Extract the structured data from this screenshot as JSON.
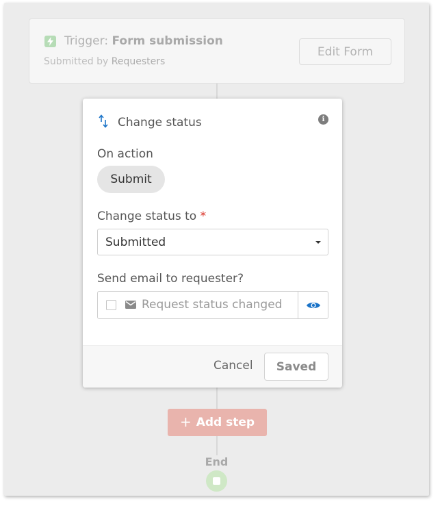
{
  "trigger": {
    "prefix": "Trigger:",
    "name": "Form submission",
    "sub_prefix": "Submitted by",
    "sub_value": "Requesters",
    "edit_button": "Edit Form"
  },
  "modal": {
    "title": "Change status",
    "info_icon_glyph": "i",
    "on_action_label": "On action",
    "action_value": "Submit",
    "change_status_label": "Change status to",
    "required_marker": "*",
    "status_value": "Submitted",
    "send_email_label": "Send email to requester?",
    "email_template": "Request status changed",
    "email_checked": false,
    "cancel_label": "Cancel",
    "saved_label": "Saved"
  },
  "workflow": {
    "add_step_plus": "+",
    "add_step_label": "Add step",
    "end_label": "End"
  },
  "colors": {
    "accent_blue": "#1a73c8",
    "required_red": "#d93025",
    "add_step_bg": "#e9b4ad",
    "trigger_green": "#b6dcb6"
  },
  "icons": [
    "lightning-icon",
    "swap-arrows-icon",
    "info-icon",
    "chevron-down-icon",
    "checkbox-icon",
    "mail-icon",
    "eye-icon",
    "plus-icon",
    "stop-icon"
  ]
}
